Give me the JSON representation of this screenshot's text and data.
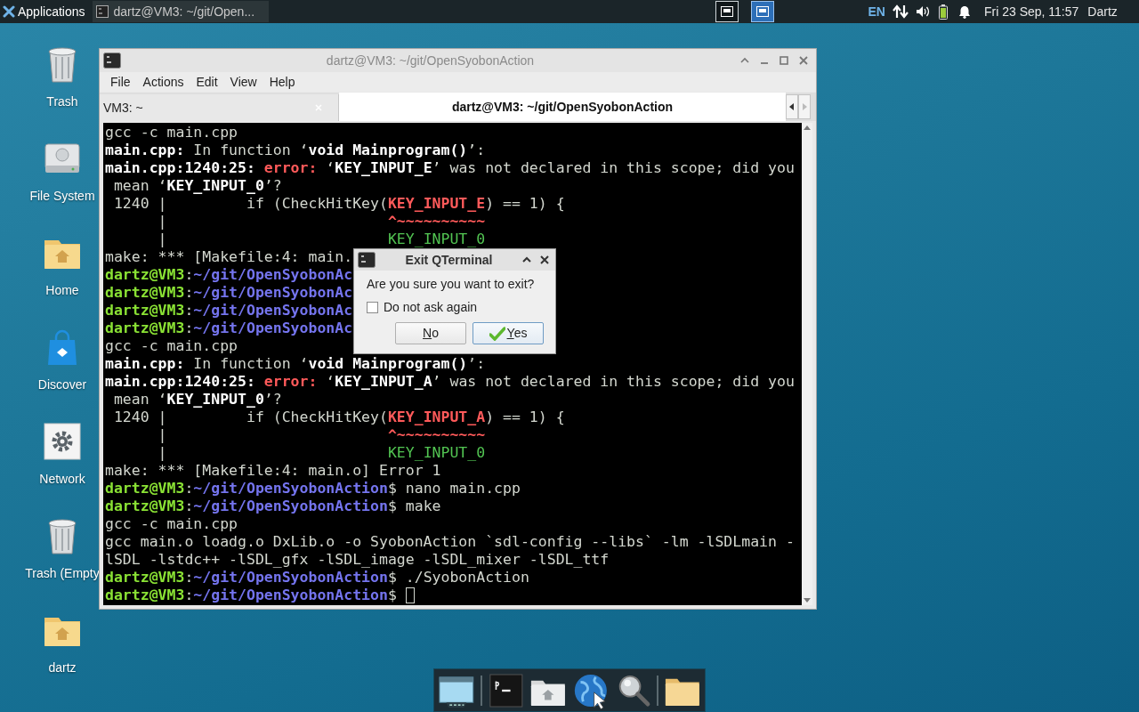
{
  "top_panel": {
    "menu_label": "Applications",
    "task": {
      "label": "dartz@VM3: ~/git/Open..."
    },
    "workspaces": [
      {
        "selected": false
      },
      {
        "selected": true
      }
    ],
    "keyboard_layout": "EN",
    "clock": "Fri 23 Sep, 11:57",
    "user": "Dartz"
  },
  "desktop_icons": [
    {
      "kind": "trash",
      "label": "Trash"
    },
    {
      "kind": "drive",
      "label": "File System"
    },
    {
      "kind": "home",
      "label": "Home"
    },
    {
      "kind": "bag",
      "label": "Discover"
    },
    {
      "kind": "gear",
      "label": "Network"
    },
    {
      "kind": "trash",
      "label": "Trash (Empty"
    },
    {
      "kind": "home",
      "label": "dartz"
    }
  ],
  "window": {
    "title": "dartz@VM3: ~/git/OpenSyobonAction",
    "menu": [
      "File",
      "Actions",
      "Edit",
      "View",
      "Help"
    ],
    "tabs": [
      {
        "label": "VM3: ~",
        "selected": false
      },
      {
        "label": "dartz@VM3: ~/git/OpenSyobonAction",
        "selected": true
      }
    ],
    "terminal_lines": [
      [
        {
          "kind": "text",
          "text": "gcc -c main.cpp"
        }
      ],
      [
        {
          "kind": "bold",
          "text": "main.cpp:"
        },
        {
          "kind": "text",
          "text": " In function ‘"
        },
        {
          "kind": "bold",
          "text": "void Mainprogram()"
        },
        {
          "kind": "text",
          "text": "’:"
        }
      ],
      [
        {
          "kind": "bold",
          "text": "main.cpp:1240:25: "
        },
        {
          "kind": "error",
          "text": "error: "
        },
        {
          "kind": "text",
          "text": "‘"
        },
        {
          "kind": "bold",
          "text": "KEY_INPUT_E"
        },
        {
          "kind": "text",
          "text": "’ was not declared in this scope; did you"
        }
      ],
      [
        {
          "kind": "text",
          "text": " mean ‘"
        },
        {
          "kind": "bold",
          "text": "KEY_INPUT_0"
        },
        {
          "kind": "text",
          "text": "’?"
        }
      ],
      [
        {
          "kind": "text",
          "text": " 1240 |         if (CheckHitKey("
        },
        {
          "kind": "error",
          "text": "KEY_INPUT_E"
        },
        {
          "kind": "text",
          "text": ") == 1) {"
        }
      ],
      [
        {
          "kind": "text",
          "text": "      |                         "
        },
        {
          "kind": "error",
          "text": "^~~~~~~~~~~"
        }
      ],
      [
        {
          "kind": "text",
          "text": "      |                         "
        },
        {
          "kind": "hint",
          "text": "KEY_INPUT_0"
        }
      ],
      [
        {
          "kind": "text",
          "text": "make: *** [Makefile:4: main."
        }
      ],
      [
        {
          "kind": "user",
          "text": "dartz@VM3"
        },
        {
          "kind": "text",
          "text": ":"
        },
        {
          "kind": "path",
          "text": "~/git/OpenSyobonAc"
        }
      ],
      [
        {
          "kind": "user",
          "text": "dartz@VM3"
        },
        {
          "kind": "text",
          "text": ":"
        },
        {
          "kind": "path",
          "text": "~/git/OpenSyobonAc"
        }
      ],
      [
        {
          "kind": "user",
          "text": "dartz@VM3"
        },
        {
          "kind": "text",
          "text": ":"
        },
        {
          "kind": "path",
          "text": "~/git/OpenSyobonAc"
        }
      ],
      [
        {
          "kind": "user",
          "text": "dartz@VM3"
        },
        {
          "kind": "text",
          "text": ":"
        },
        {
          "kind": "path",
          "text": "~/git/OpenSyobonAc"
        }
      ],
      [
        {
          "kind": "text",
          "text": "gcc -c main.cpp"
        }
      ],
      [
        {
          "kind": "bold",
          "text": "main.cpp:"
        },
        {
          "kind": "text",
          "text": " In function ‘"
        },
        {
          "kind": "bold",
          "text": "void Mainprogram()"
        },
        {
          "kind": "text",
          "text": "’:"
        }
      ],
      [
        {
          "kind": "bold",
          "text": "main.cpp:1240:25: "
        },
        {
          "kind": "error",
          "text": "error: "
        },
        {
          "kind": "text",
          "text": "‘"
        },
        {
          "kind": "bold",
          "text": "KEY_INPUT_A"
        },
        {
          "kind": "text",
          "text": "’ was not declared in this scope; did you"
        }
      ],
      [
        {
          "kind": "text",
          "text": " mean ‘"
        },
        {
          "kind": "bold",
          "text": "KEY_INPUT_0"
        },
        {
          "kind": "text",
          "text": "’?"
        }
      ],
      [
        {
          "kind": "text",
          "text": " 1240 |         if (CheckHitKey("
        },
        {
          "kind": "error",
          "text": "KEY_INPUT_A"
        },
        {
          "kind": "text",
          "text": ") == 1) {"
        }
      ],
      [
        {
          "kind": "text",
          "text": "      |                         "
        },
        {
          "kind": "error",
          "text": "^~~~~~~~~~~"
        }
      ],
      [
        {
          "kind": "text",
          "text": "      |                         "
        },
        {
          "kind": "hint",
          "text": "KEY_INPUT_0"
        }
      ],
      [
        {
          "kind": "text",
          "text": "make: *** [Makefile:4: main.o] Error 1"
        }
      ],
      [
        {
          "kind": "user",
          "text": "dartz@VM3"
        },
        {
          "kind": "text",
          "text": ":"
        },
        {
          "kind": "path",
          "text": "~/git/OpenSyobonAction"
        },
        {
          "kind": "text",
          "text": "$ nano main.cpp"
        }
      ],
      [
        {
          "kind": "user",
          "text": "dartz@VM3"
        },
        {
          "kind": "text",
          "text": ":"
        },
        {
          "kind": "path",
          "text": "~/git/OpenSyobonAction"
        },
        {
          "kind": "text",
          "text": "$ make"
        }
      ],
      [
        {
          "kind": "text",
          "text": "gcc -c main.cpp"
        }
      ],
      [
        {
          "kind": "text",
          "text": "gcc main.o loadg.o DxLib.o -o SyobonAction `sdl-config --libs` -lm -lSDLmain -"
        }
      ],
      [
        {
          "kind": "text",
          "text": "lSDL -lstdc++ -lSDL_gfx -lSDL_image -lSDL_mixer -lSDL_ttf"
        }
      ],
      [
        {
          "kind": "user",
          "text": "dartz@VM3"
        },
        {
          "kind": "text",
          "text": ":"
        },
        {
          "kind": "path",
          "text": "~/git/OpenSyobonAction"
        },
        {
          "kind": "text",
          "text": "$ ./SyobonAction"
        }
      ],
      [
        {
          "kind": "user",
          "text": "dartz@VM3"
        },
        {
          "kind": "text",
          "text": ":"
        },
        {
          "kind": "path",
          "text": "~/git/OpenSyobonAction"
        },
        {
          "kind": "text",
          "text": "$ "
        },
        {
          "kind": "cursor"
        }
      ]
    ]
  },
  "dialog": {
    "title": "Exit QTerminal",
    "message": "Are you sure you want to exit?",
    "checkbox": {
      "label": "Do not ask again",
      "checked": false
    },
    "buttons": [
      {
        "kind": "plain",
        "label": "No"
      },
      {
        "kind": "default",
        "label": "Yes"
      }
    ]
  },
  "dock": [
    {
      "kind": "window"
    },
    {
      "kind": "separator"
    },
    {
      "kind": "terminal"
    },
    {
      "kind": "home"
    },
    {
      "kind": "globe"
    },
    {
      "kind": "search"
    },
    {
      "kind": "separator"
    },
    {
      "kind": "folder"
    }
  ]
}
